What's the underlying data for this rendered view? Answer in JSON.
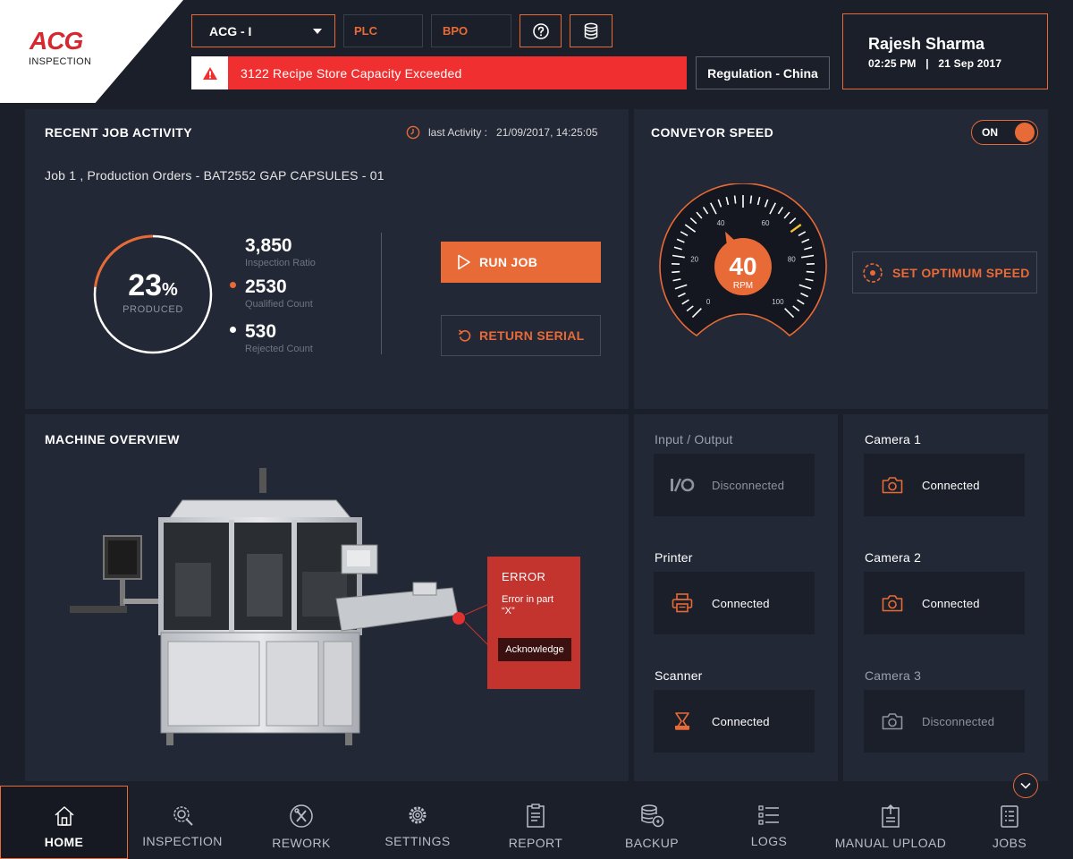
{
  "header": {
    "logo": "ACG",
    "logo_sub": "INSPECTION",
    "line_select": "ACG - I",
    "plc_label": "PLC",
    "bpo_label": "BPO",
    "alert_text": "3122 Recipe Store Capacity Exceeded",
    "regulation": "Regulation - China",
    "user_name": "Rajesh Sharma",
    "user_datetime": "02:25 PM   |   21 Sep 2017"
  },
  "job_activity": {
    "title": "RECENT JOB ACTIVITY",
    "last_activity": "last Activity :   21/09/2017, 14:25:05",
    "job_desc": "Job 1 , Production Orders - BAT2552 GAP CAPSULES - 01",
    "produced_pct": "23",
    "produced_fraction": 0.23,
    "pct_symbol": "%",
    "produced_label": "PRODUCED",
    "stats": [
      {
        "value": "3,850",
        "label": "Inspection Ratio"
      },
      {
        "value": "2530",
        "label": "Qualified Count"
      },
      {
        "value": "530",
        "label": "Rejected Count"
      }
    ],
    "run_job": "RUN JOB",
    "return_serial": "RETURN SERIAL"
  },
  "conveyor": {
    "title": "CONVEYOR SPEED",
    "toggle": "ON",
    "speed": "40",
    "unit": "RPM",
    "speed_value": 40,
    "max_marker": 70,
    "ticks": [
      "0",
      "20",
      "40",
      "60",
      "80",
      "100"
    ],
    "optimum_btn": "SET OPTIMUM SPEED"
  },
  "machine": {
    "title": "MACHINE OVERVIEW",
    "error_title": "ERROR",
    "error_msg_1": "Error in part",
    "error_msg_2": "“X”",
    "acknowledge": "Acknowledge"
  },
  "devices": {
    "io": {
      "label": "Input / Output",
      "status": "Disconnected",
      "icon": "io-icon"
    },
    "printer": {
      "label": "Printer",
      "status": "Connected",
      "icon": "printer-icon"
    },
    "scanner": {
      "label": "Scanner",
      "status": "Connected",
      "icon": "scanner-icon"
    },
    "camera1": {
      "label": "Camera 1",
      "status": "Connected",
      "icon": "camera-icon"
    },
    "camera2": {
      "label": "Camera 2",
      "status": "Connected",
      "icon": "camera-icon"
    },
    "camera3": {
      "label": "Camera 3",
      "status": "Disconnected",
      "icon": "camera-icon"
    }
  },
  "nav": {
    "items": [
      {
        "label": "HOME",
        "icon": "home-icon"
      },
      {
        "label": "INSPECTION",
        "icon": "inspection-icon"
      },
      {
        "label": "REWORK",
        "icon": "rework-icon"
      },
      {
        "label": "SETTINGS",
        "icon": "gear-icon"
      },
      {
        "label": "REPORT",
        "icon": "report-icon"
      },
      {
        "label": "BACKUP",
        "icon": "backup-icon"
      },
      {
        "label": "LOGS",
        "icon": "logs-icon"
      },
      {
        "label": "MANUAL UPLOAD",
        "icon": "upload-icon"
      },
      {
        "label": "JOBS",
        "icon": "jobs-icon"
      }
    ]
  },
  "colors": {
    "accent": "#e86a36",
    "alert": "#f03030",
    "error_card": "#c3342e",
    "background": "#1b1f29",
    "panel": "#232836"
  }
}
